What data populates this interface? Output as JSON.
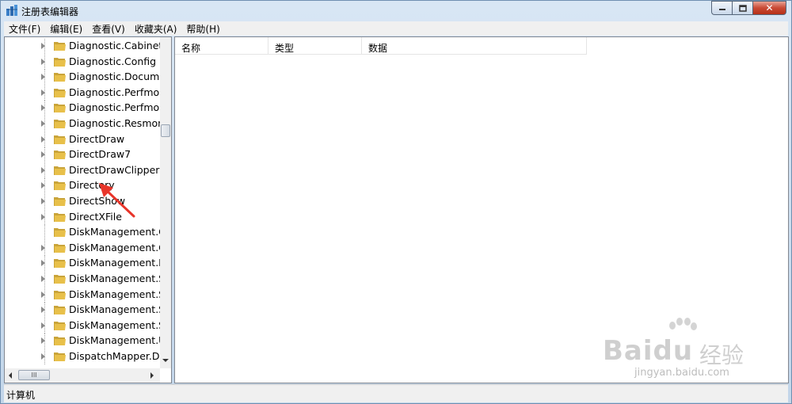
{
  "window": {
    "title": "注册表编辑器"
  },
  "caption_buttons": {
    "close_glyph": "✕"
  },
  "menu": [
    {
      "label": "文件(F)"
    },
    {
      "label": "编辑(E)"
    },
    {
      "label": "查看(V)"
    },
    {
      "label": "收藏夹(A)"
    },
    {
      "label": "帮助(H)"
    }
  ],
  "tree": {
    "items": [
      {
        "label": "Diagnostic.Cabinet",
        "expandable": true
      },
      {
        "label": "Diagnostic.Config",
        "expandable": true
      },
      {
        "label": "Diagnostic.Documer",
        "expandable": true
      },
      {
        "label": "Diagnostic.Perfmon",
        "expandable": true
      },
      {
        "label": "Diagnostic.Perfmon",
        "expandable": true
      },
      {
        "label": "Diagnostic.Resmon.",
        "expandable": true
      },
      {
        "label": "DirectDraw",
        "expandable": true
      },
      {
        "label": "DirectDraw7",
        "expandable": true
      },
      {
        "label": "DirectDrawClipper",
        "expandable": true
      },
      {
        "label": "Directory",
        "expandable": true
      },
      {
        "label": "DirectShow",
        "expandable": true
      },
      {
        "label": "DirectXFile",
        "expandable": true
      },
      {
        "label": "DiskManagement.C",
        "expandable": false
      },
      {
        "label": "DiskManagement.C",
        "expandable": true
      },
      {
        "label": "DiskManagement.D",
        "expandable": true
      },
      {
        "label": "DiskManagement.Si",
        "expandable": true
      },
      {
        "label": "DiskManagement.Si",
        "expandable": true
      },
      {
        "label": "DiskManagement.Si",
        "expandable": true
      },
      {
        "label": "DiskManagement.Si",
        "expandable": true
      },
      {
        "label": "DiskManagement.U",
        "expandable": true
      },
      {
        "label": "DispatchMapper.Di:",
        "expandable": true
      }
    ],
    "hscroll_thumb_glyph": "III"
  },
  "columns": [
    {
      "label": "名称"
    },
    {
      "label": "类型"
    },
    {
      "label": "数据"
    }
  ],
  "status": {
    "text": "计算机"
  },
  "watermark": {
    "brand": "Baidu",
    "cn": "经验",
    "url": "jingyan.baidu.com"
  },
  "colors": {
    "annotation_arrow": "#e8352a",
    "folder": "#e8c04a"
  }
}
